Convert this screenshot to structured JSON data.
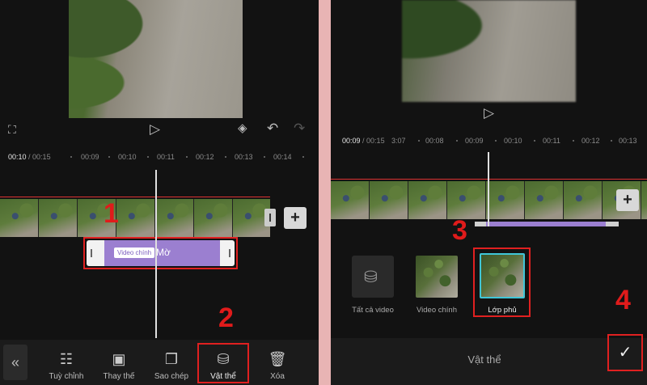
{
  "left": {
    "timecode_current": "00:10",
    "timecode_total": "00:15",
    "ruler_ticks": [
      "00:09",
      "00:10",
      "00:11",
      "00:12",
      "00:13",
      "00:14"
    ],
    "main_clip_badge": "Video chính",
    "main_clip_label": "Mờ",
    "step1": "1",
    "step2": "2",
    "toolbar": [
      {
        "label": "Tuỳ chỉnh",
        "icon": "sliders-icon"
      },
      {
        "label": "Thay thế",
        "icon": "replace-icon"
      },
      {
        "label": "Sao chép",
        "icon": "copy-icon"
      },
      {
        "label": "Vật thể",
        "icon": "layers-icon"
      },
      {
        "label": "Xóa",
        "icon": "trash-icon"
      }
    ]
  },
  "right": {
    "timecode_current": "00:09",
    "timecode_total": "00:15",
    "ruler_ticks": [
      "3:07",
      "00:08",
      "00:09",
      "00:10",
      "00:11",
      "00:12",
      "00:13"
    ],
    "options": [
      {
        "label": "Tất cả video"
      },
      {
        "label": "Video chính"
      },
      {
        "label": "Lớp phủ"
      }
    ],
    "step3": "3",
    "step4": "4",
    "footer_title": "Vật thể"
  },
  "colors": {
    "accent_purple": "#9b7fd0",
    "highlight_red": "#e02020",
    "selected_cyan": "#3fc6d8"
  }
}
